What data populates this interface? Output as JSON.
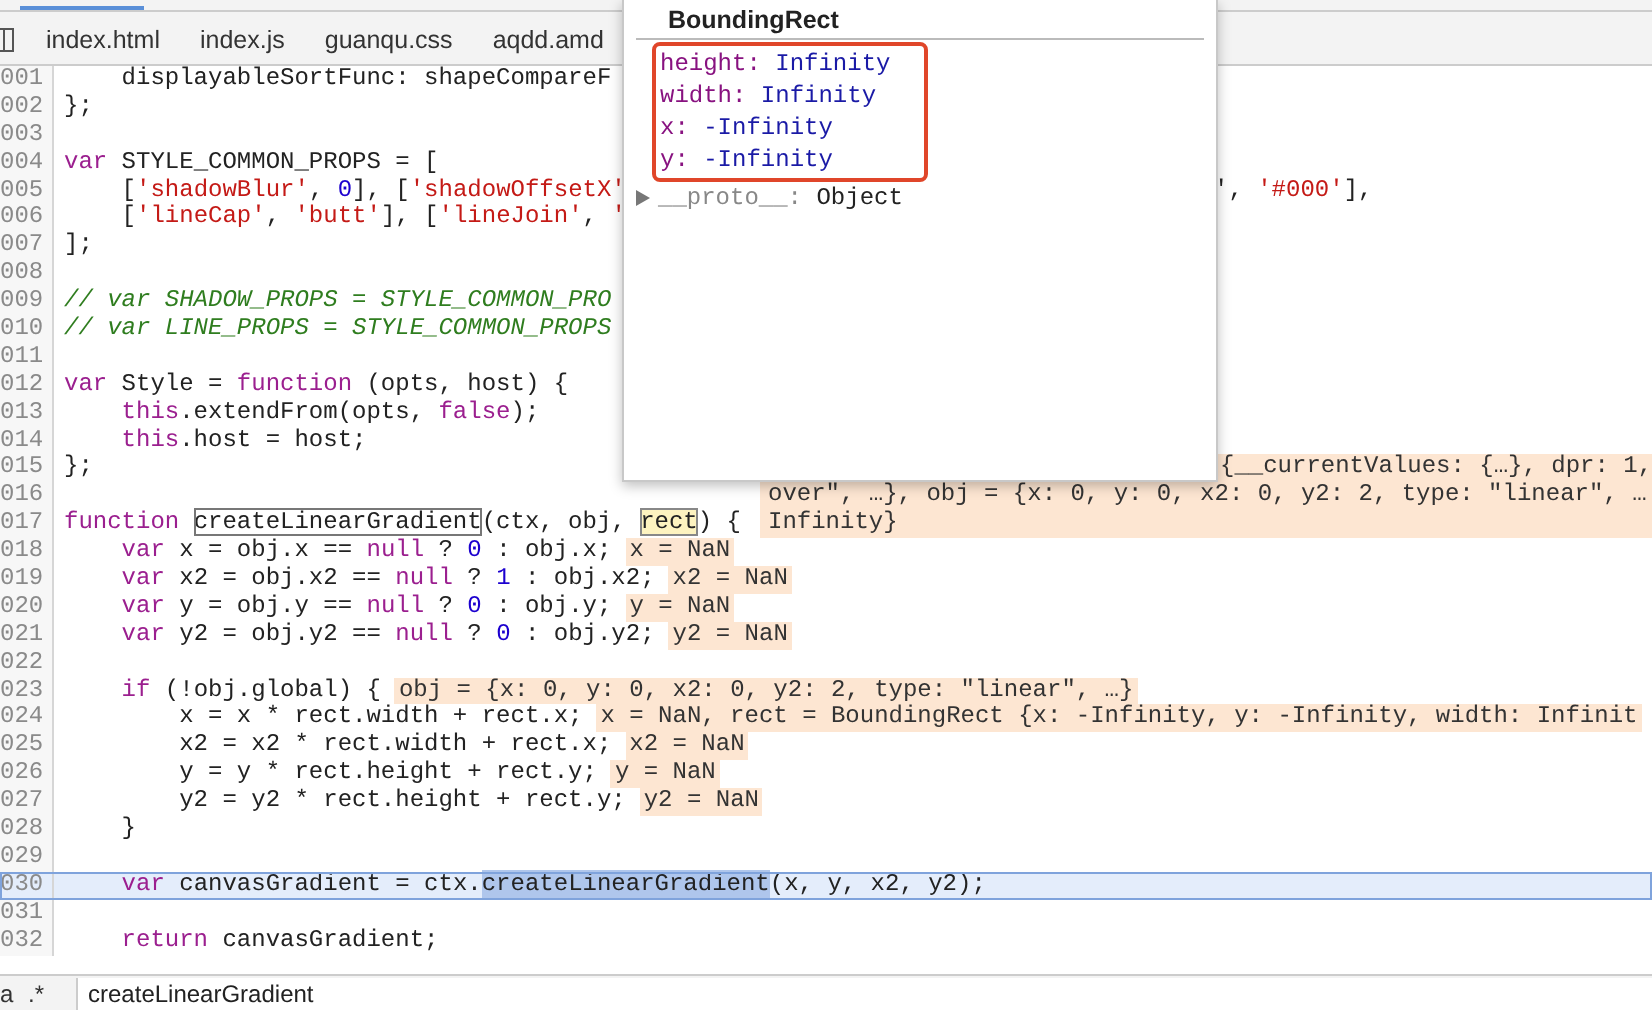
{
  "tabs": [
    {
      "label": "index.html"
    },
    {
      "label": "index.js"
    },
    {
      "label": "guanqu.css"
    },
    {
      "label": "aqdd.amd"
    }
  ],
  "editor": {
    "lines": [
      {
        "number": "001",
        "current": false,
        "tokens": [
          {
            "kind": "plain",
            "text": "    displayableSortFunc: shapeCompareF"
          }
        ]
      },
      {
        "number": "002",
        "current": false,
        "tokens": [
          {
            "kind": "plain",
            "text": "};"
          }
        ]
      },
      {
        "number": "003",
        "current": false
      },
      {
        "number": "004",
        "current": false,
        "tokens": [
          {
            "kind": "keyword",
            "text": "var"
          },
          {
            "kind": "plain",
            "text": " STYLE_COMMON_PROPS = ["
          }
        ]
      },
      {
        "number": "005",
        "current": false,
        "tokens": [
          {
            "kind": "plain",
            "text": "    ["
          },
          {
            "kind": "string",
            "text": "'shadowBlur'"
          },
          {
            "kind": "plain",
            "text": ", "
          },
          {
            "kind": "number",
            "text": "0"
          },
          {
            "kind": "plain",
            "text": "], ["
          },
          {
            "kind": "string",
            "text": "'shadowOffsetX'"
          },
          {
            "kind": "right_fragment",
            "text": "', '#000'],"
          }
        ]
      },
      {
        "number": "006",
        "current": false,
        "tokens": [
          {
            "kind": "plain",
            "text": "    ["
          },
          {
            "kind": "string",
            "text": "'lineCap'"
          },
          {
            "kind": "plain",
            "text": ", "
          },
          {
            "kind": "string",
            "text": "'butt'"
          },
          {
            "kind": "plain",
            "text": "], ["
          },
          {
            "kind": "string",
            "text": "'lineJoin'"
          },
          {
            "kind": "plain",
            "text": ", "
          },
          {
            "kind": "string",
            "text": "'"
          }
        ]
      },
      {
        "number": "007",
        "current": false,
        "tokens": [
          {
            "kind": "plain",
            "text": "];"
          }
        ]
      },
      {
        "number": "008",
        "current": false
      },
      {
        "number": "009",
        "current": false,
        "tokens": [
          {
            "kind": "comment",
            "text": "// var SHADOW_PROPS = STYLE_COMMON_PRO"
          }
        ]
      },
      {
        "number": "010",
        "current": false,
        "tokens": [
          {
            "kind": "comment",
            "text": "// var LINE_PROPS = STYLE_COMMON_PROPS"
          }
        ]
      },
      {
        "number": "011",
        "current": false
      },
      {
        "number": "012",
        "current": false,
        "tokens": [
          {
            "kind": "keyword",
            "text": "var"
          },
          {
            "kind": "plain",
            "text": " Style = "
          },
          {
            "kind": "keyword",
            "text": "function"
          },
          {
            "kind": "plain",
            "text": " (opts, host) {"
          }
        ]
      },
      {
        "number": "013",
        "current": false,
        "tokens": [
          {
            "kind": "keyword",
            "text": "    this"
          },
          {
            "kind": "plain",
            "text": ".extendFrom(opts, "
          },
          {
            "kind": "keyword",
            "text": "false"
          },
          {
            "kind": "plain",
            "text": ");"
          }
        ]
      },
      {
        "number": "014",
        "current": false,
        "tokens": [
          {
            "kind": "keyword",
            "text": "    this"
          },
          {
            "kind": "plain",
            "text": ".host = host;"
          }
        ]
      },
      {
        "number": "015",
        "current": false,
        "tokens": [
          {
            "kind": "plain",
            "text": "};"
          }
        ]
      },
      {
        "number": "016",
        "current": false
      },
      {
        "number": "017",
        "current": false,
        "tokens": [
          {
            "kind": "keyword",
            "text": "function "
          },
          {
            "kind": "search_match",
            "text": "createLinearGradient"
          },
          {
            "kind": "plain",
            "text": "(ctx, obj, "
          },
          {
            "kind": "hover_target",
            "text": "rect"
          },
          {
            "kind": "plain",
            "text": ") {"
          }
        ],
        "value_lines": [
          "{__currentValues: {…}, dpr: 1,",
          "over\", …}, obj = {x: 0, y: 0, x2: 0, y2: 2, type: \"linear\", …",
          "Infinity}"
        ]
      },
      {
        "number": "018",
        "current": false,
        "tokens": [
          {
            "kind": "keyword",
            "text": "    var"
          },
          {
            "kind": "plain",
            "text": " x = obj.x == "
          },
          {
            "kind": "keyword",
            "text": "null"
          },
          {
            "kind": "plain",
            "text": " ? "
          },
          {
            "kind": "number",
            "text": "0"
          },
          {
            "kind": "plain",
            "text": " : obj.x;"
          }
        ],
        "value": "x = NaN"
      },
      {
        "number": "019",
        "current": false,
        "tokens": [
          {
            "kind": "keyword",
            "text": "    var"
          },
          {
            "kind": "plain",
            "text": " x2 = obj.x2 == "
          },
          {
            "kind": "keyword",
            "text": "null"
          },
          {
            "kind": "plain",
            "text": " ? "
          },
          {
            "kind": "number",
            "text": "1"
          },
          {
            "kind": "plain",
            "text": " : obj.x2;"
          }
        ],
        "value": "x2 = NaN"
      },
      {
        "number": "020",
        "current": false,
        "tokens": [
          {
            "kind": "keyword",
            "text": "    var"
          },
          {
            "kind": "plain",
            "text": " y = obj.y == "
          },
          {
            "kind": "keyword",
            "text": "null"
          },
          {
            "kind": "plain",
            "text": " ? "
          },
          {
            "kind": "number",
            "text": "0"
          },
          {
            "kind": "plain",
            "text": " : obj.y;"
          }
        ],
        "value": "y = NaN"
      },
      {
        "number": "021",
        "current": false,
        "tokens": [
          {
            "kind": "keyword",
            "text": "    var"
          },
          {
            "kind": "plain",
            "text": " y2 = obj.y2 == "
          },
          {
            "kind": "keyword",
            "text": "null"
          },
          {
            "kind": "plain",
            "text": " ? "
          },
          {
            "kind": "number",
            "text": "0"
          },
          {
            "kind": "plain",
            "text": " : obj.y2;"
          }
        ],
        "value": "y2 = NaN"
      },
      {
        "number": "022",
        "current": false
      },
      {
        "number": "023",
        "current": false,
        "tokens": [
          {
            "kind": "keyword",
            "text": "    if"
          },
          {
            "kind": "plain",
            "text": " (!obj.global) {"
          }
        ],
        "value": "obj = {x: 0, y: 0, x2: 0, y2: 2, type: \"linear\", …}"
      },
      {
        "number": "024",
        "current": false,
        "tokens": [
          {
            "kind": "plain",
            "text": "        x = x * rect.width + rect.x;"
          }
        ],
        "value": "x = NaN, rect = BoundingRect {x: -Infinity, y: -Infinity, width: Infinit"
      },
      {
        "number": "025",
        "current": false,
        "tokens": [
          {
            "kind": "plain",
            "text": "        x2 = x2 * rect.width + rect.x;"
          }
        ],
        "value": "x2 = NaN"
      },
      {
        "number": "026",
        "current": false,
        "tokens": [
          {
            "kind": "plain",
            "text": "        y = y * rect.height + rect.y;"
          }
        ],
        "value": "y = NaN"
      },
      {
        "number": "027",
        "current": false,
        "tokens": [
          {
            "kind": "plain",
            "text": "        y2 = y2 * rect.height + rect.y;"
          }
        ],
        "value": "y2 = NaN"
      },
      {
        "number": "028",
        "current": false,
        "tokens": [
          {
            "kind": "plain",
            "text": "    }"
          }
        ]
      },
      {
        "number": "029",
        "current": false
      },
      {
        "number": "030",
        "current": true,
        "tokens": [
          {
            "kind": "keyword",
            "text": "    var"
          },
          {
            "kind": "plain",
            "text": " canvasGradient = ctx."
          },
          {
            "kind": "selection",
            "text": "createLinearGradient"
          },
          {
            "kind": "plain",
            "text": "(x, y, x2, y2);"
          }
        ]
      },
      {
        "number": "031",
        "current": false
      },
      {
        "number": "032",
        "current": false,
        "tokens": [
          {
            "kind": "keyword",
            "text": "    return"
          },
          {
            "kind": "plain",
            "text": " canvasGradient;"
          }
        ]
      }
    ]
  },
  "popover": {
    "title": "BoundingRect",
    "outlined": true,
    "properties": [
      {
        "name": "height:",
        "value": "Infinity"
      },
      {
        "name": "width:",
        "value": "Infinity"
      },
      {
        "name": "x:",
        "value": "-Infinity"
      },
      {
        "name": "y:",
        "value": "-Infinity"
      }
    ],
    "proto": {
      "name": "__proto__:",
      "value": "Object"
    }
  },
  "search": {
    "case_toggle": "a",
    "regex_toggle": ".*",
    "value": "createLinearGradient"
  }
}
